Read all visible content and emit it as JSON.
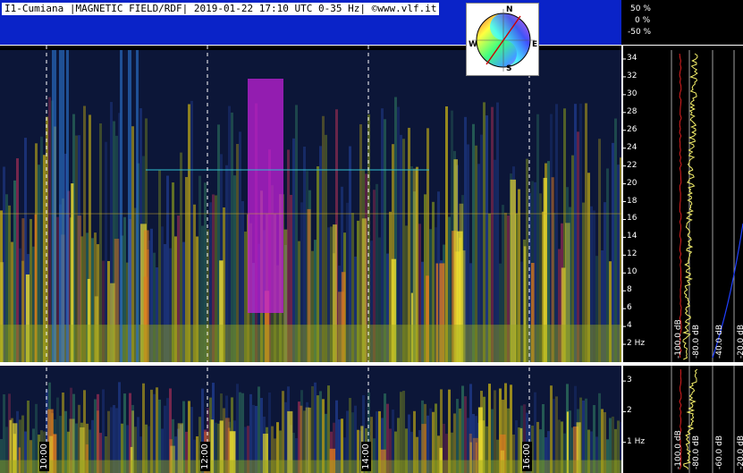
{
  "header": {
    "title": "I1-Cumiana |MAGNETIC FIELD/RDF| 2019-01-22 17:10 UTC 0-35 Hz| ©www.vlf.it"
  },
  "amplitude_scale": {
    "labels": [
      "50 %",
      "0 %",
      "-50 %"
    ]
  },
  "compass": {
    "north": "N",
    "south": "S",
    "east": "E",
    "west": "W"
  },
  "colors": {
    "header_band": "#0a23c8",
    "background": "#000000",
    "trace_yellow": "#f5f06a",
    "trace_red": "#e02020"
  },
  "chart_data": [
    {
      "type": "heatmap",
      "name": "upper spectrogram",
      "y_ticks": [
        "2 Hz",
        "4",
        "6",
        "8",
        "10",
        "12",
        "14",
        "16",
        "18",
        "20",
        "22",
        "24",
        "26",
        "28",
        "30",
        "32",
        "34"
      ],
      "ylim": [
        0,
        35
      ],
      "y_unit": "Hz",
      "x_ticks": [
        "10:00",
        "12:00",
        "14:00",
        "16:00"
      ],
      "grid": true
    },
    {
      "type": "heatmap",
      "name": "lower spectrogram",
      "y_ticks": [
        "1 Hz",
        "2",
        "3"
      ],
      "ylim": [
        0,
        3.5
      ],
      "x_ticks": [
        "10:00",
        "12:00",
        "14:00",
        "16:00"
      ],
      "grid": true
    },
    {
      "type": "line",
      "name": "spectrum upper",
      "x_ticks": [
        "-100.0 dB",
        "-80.0 dB",
        "-40.0 dB",
        "-20.0 dB"
      ],
      "grid": true
    },
    {
      "type": "line",
      "name": "spectrum lower",
      "x_ticks": [
        "-100.0 dB",
        "-80.0 dB",
        "-60.0 dB",
        "-20.0 dB"
      ],
      "grid": true
    }
  ]
}
